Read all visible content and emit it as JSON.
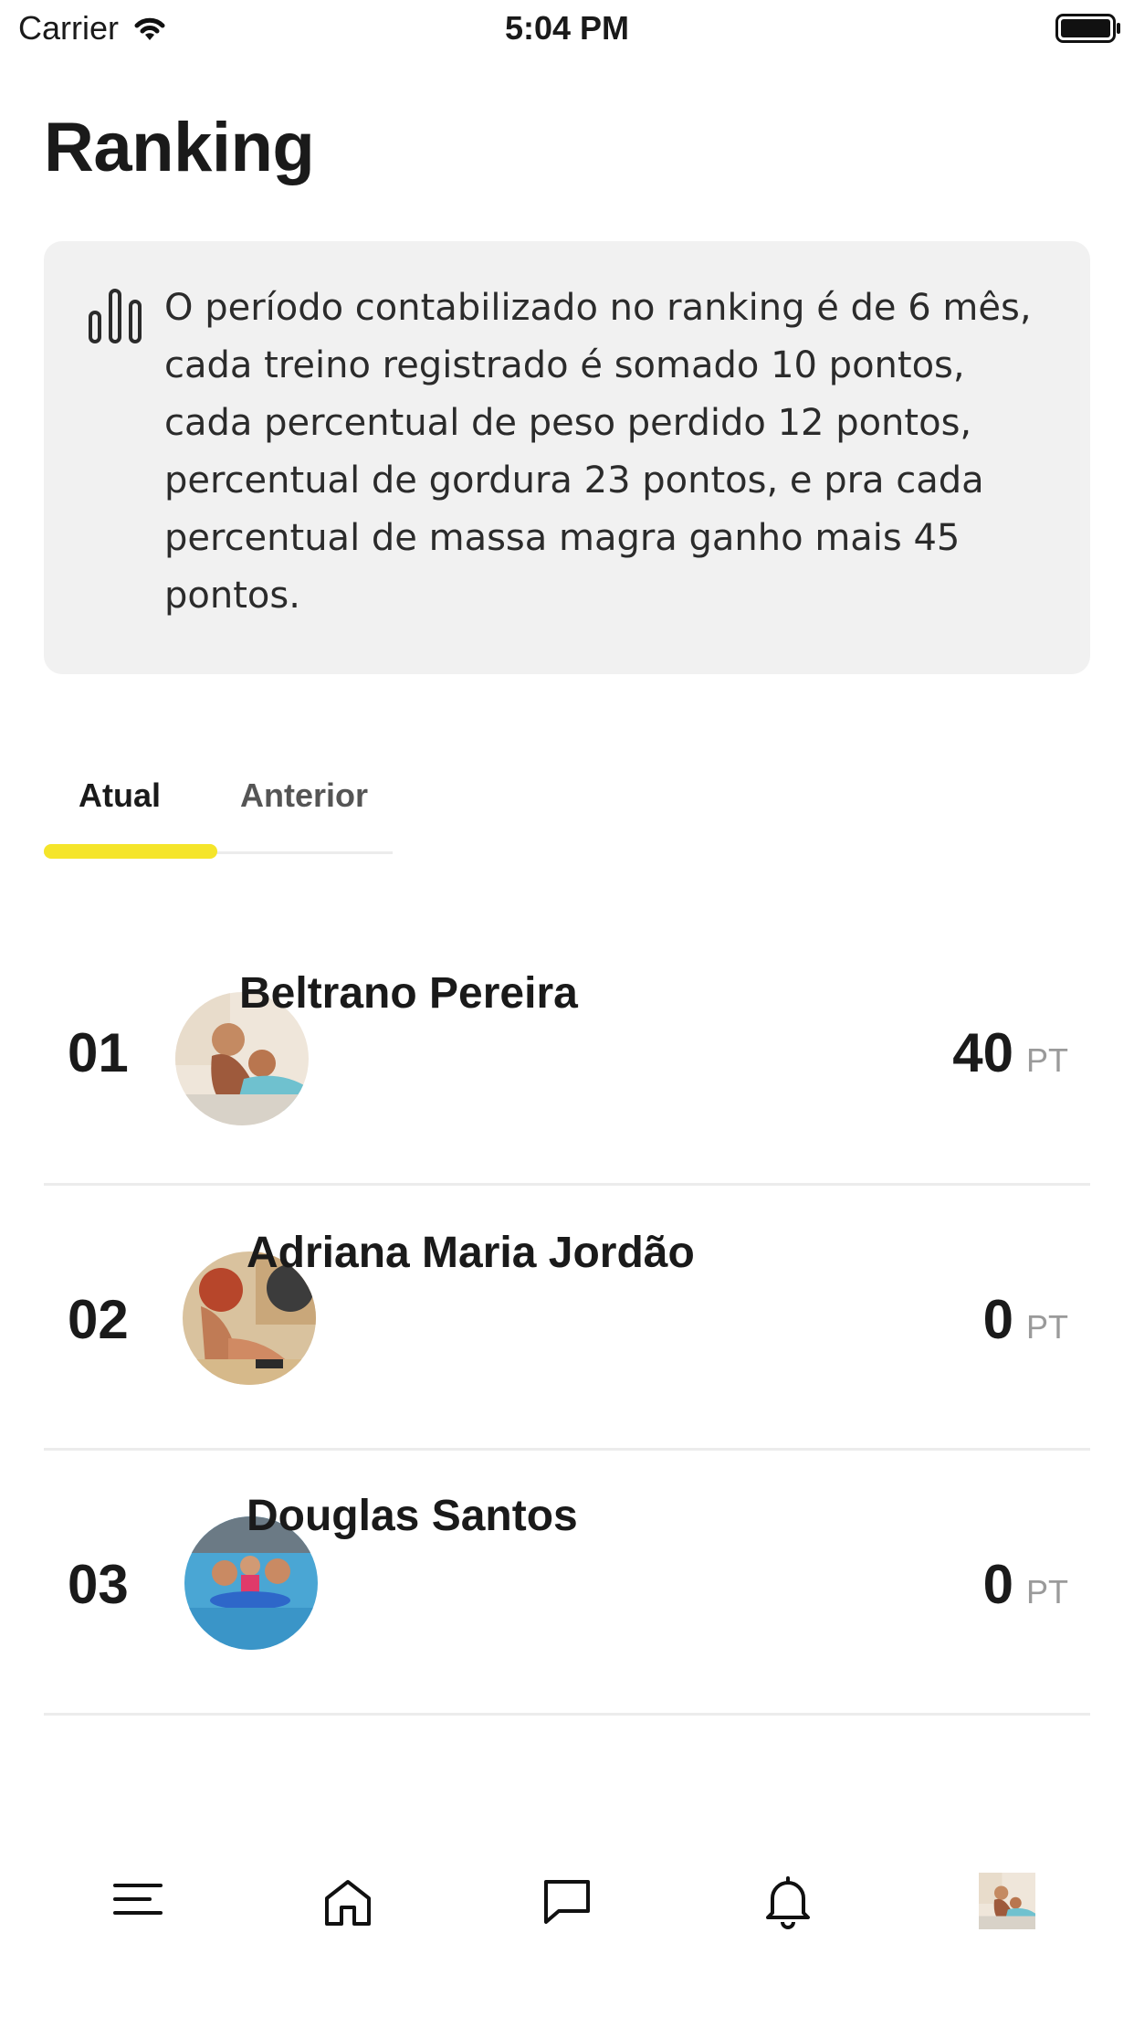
{
  "status_bar": {
    "carrier": "Carrier",
    "time": "5:04 PM"
  },
  "page_title": "Ranking",
  "info": {
    "icon": "bar-chart-icon",
    "text": "O período contabilizado no ranking é de 6 mês, cada treino registrado é somado 10 pontos, cada percentual de peso perdido 12 pontos, percentual de gordura 23 pontos, e pra cada percentual de massa magra ganho mais 45 pontos."
  },
  "tabs": [
    {
      "label": "Atual",
      "active": true
    },
    {
      "label": "Anterior",
      "active": false
    }
  ],
  "accent_color": "#f5e52a",
  "ranking": [
    {
      "position": "01",
      "name": "Beltrano Pereira",
      "points": "40",
      "unit": "PT"
    },
    {
      "position": "02",
      "name": "Adriana Maria Jordão",
      "points": "0",
      "unit": "PT"
    },
    {
      "position": "03",
      "name": "Douglas Santos",
      "points": "0",
      "unit": "PT"
    }
  ],
  "bottom_nav": [
    "menu-icon",
    "home-icon",
    "chat-icon",
    "bell-icon",
    "profile-avatar"
  ]
}
